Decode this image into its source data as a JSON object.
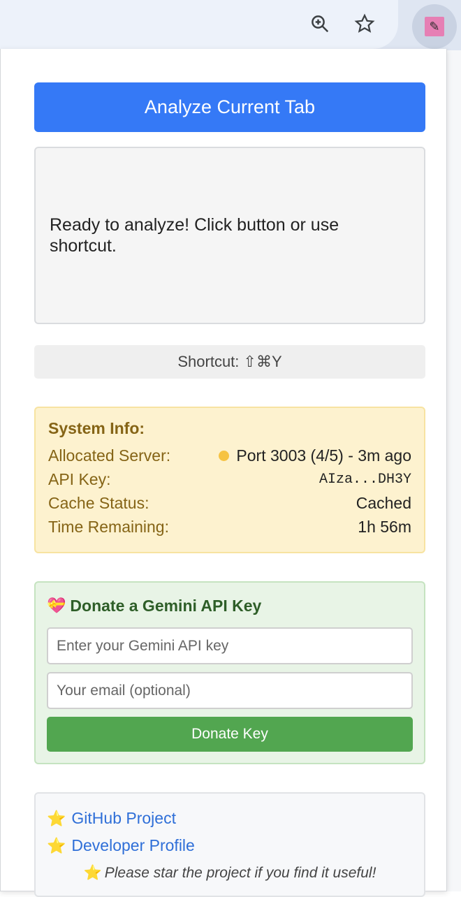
{
  "browser": {
    "zoom_icon": "zoom-in-icon",
    "bookmark_icon": "star-outline-icon",
    "extension_icon": "extension-avatar-icon"
  },
  "popup": {
    "analyze_button": "Analyze Current Tab",
    "result_text": "Ready to analyze! Click button or use shortcut.",
    "shortcut_text": "Shortcut: ⇧⌘Y",
    "system_info": {
      "title": "System Info:",
      "rows": [
        {
          "label": "Allocated Server:",
          "value": "Port 3003 (4/5) - 3m ago",
          "status_color": "#f6c343"
        },
        {
          "label": "API Key:",
          "value": "AIza...DH3Y"
        },
        {
          "label": "Cache Status:",
          "value": "Cached"
        },
        {
          "label": "Time Remaining:",
          "value": "1h 56m"
        }
      ]
    },
    "donate": {
      "title": "Donate a Gemini API Key",
      "title_icon": "heart-gift-icon",
      "api_key_placeholder": "Enter your Gemini API key",
      "email_placeholder": "Your email (optional)",
      "button": "Donate Key"
    },
    "links": {
      "github": "GitHub Project",
      "developer": "Developer Profile",
      "note": "Please star the project if you find it useful!"
    }
  },
  "colors": {
    "primary": "#3579f6",
    "donate_green": "#52a650",
    "info_label": "#856416",
    "link": "#2f6fd8"
  }
}
